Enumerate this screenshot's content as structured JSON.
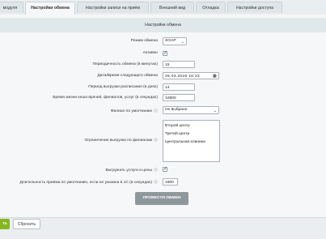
{
  "tabs": [
    {
      "label": "модуля",
      "active": false
    },
    {
      "label": "Настройки обмена",
      "active": true
    },
    {
      "label": "Настройки записи на приём",
      "active": false
    },
    {
      "label": "Внешний вид",
      "active": false
    },
    {
      "label": "Отладка",
      "active": false
    },
    {
      "label": "Настройки доступа",
      "active": false
    }
  ],
  "section_title": "Настройки обмена",
  "fields": {
    "exchange_mode": {
      "label": "Режим обмена",
      "value": "SOAP"
    },
    "active": {
      "label": "Активен",
      "checked": true
    },
    "exchange_period": {
      "label": "Периодичность обмена (в минутах)",
      "value": "15"
    },
    "next_exchange": {
      "label": "Дата/Время следующего обмена",
      "value": "26.03.2026 16:23"
    },
    "schedule_period": {
      "label": "Период выгрузки расписания (в днях)",
      "value": "14"
    },
    "cache_ttl": {
      "label": "Время жизни кеша врачей, филиалов, услуг (в секундах)",
      "value": "10800"
    },
    "default_branch": {
      "label": "Филиал по умолчанию",
      "value": "Не выбрано"
    },
    "branch_limit": {
      "label": "Ограничение выгрузки по филиалам",
      "options": [
        "Второй центр",
        "Третий центр",
        "Центральная клиника"
      ]
    },
    "export_services": {
      "label": "Выгружать услуги и цены",
      "checked": true
    },
    "default_duration": {
      "label": "Длительность приёма по умолчанию, если не указана в 1С (в секундах)",
      "value": "1800"
    }
  },
  "run_button": "ПРОВЕСТИ ОБМЕН",
  "footer": {
    "save": "ть",
    "cancel": "Сбросить"
  },
  "colors": {
    "accent": "#86b61f",
    "panel": "#f5f7f8",
    "header": "#e1e8eb"
  }
}
